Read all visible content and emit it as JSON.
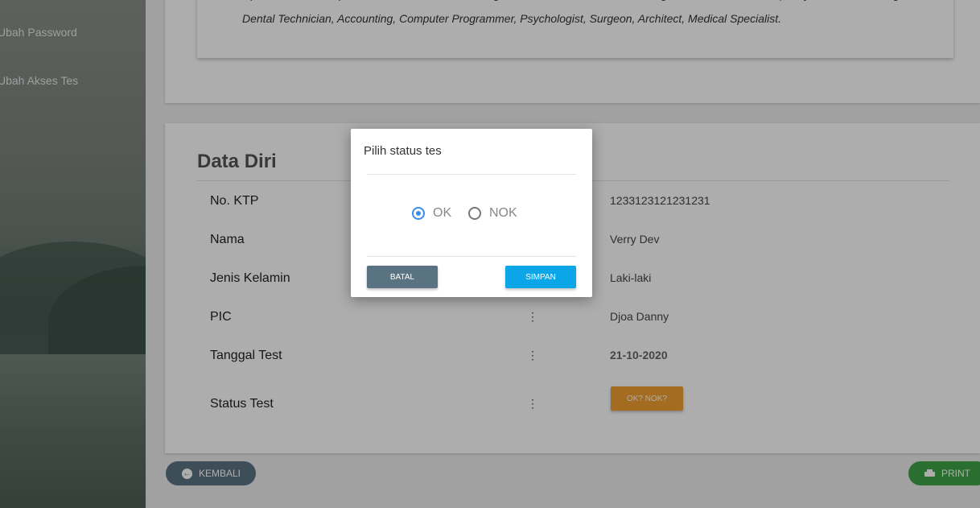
{
  "sidebar": {
    "items": [
      {
        "label": "Ubah Password"
      },
      {
        "label": "Ubah Akses Tes"
      }
    ]
  },
  "top_card": {
    "line1": "Optician, Medical Specialist, Health Care, IT Management, Planner, Technical Writing, Production, Dentist, Quality Control, Planning,",
    "line2": "Dental Technician, Accounting, Computer Programmer, Psychologist, Surgeon, Architect, Medical Specialist."
  },
  "data_diri": {
    "title": "Data Diri",
    "separator": "⋮",
    "rows": [
      {
        "label": "No. KTP",
        "value": "1233123121231231"
      },
      {
        "label": "Nama",
        "value": "Verry Dev"
      },
      {
        "label": "Jenis Kelamin",
        "value": "Laki-laki"
      },
      {
        "label": "PIC",
        "value": "Djoa Danny"
      },
      {
        "label": "Tanggal Test",
        "value": "21-10-2020"
      },
      {
        "label": "Status Test",
        "button_label": "OK? NOK?"
      }
    ]
  },
  "footer": {
    "back_label": "KEMBALI",
    "print_label": "PRINT"
  },
  "modal": {
    "title": "Pilih status tes",
    "options": [
      {
        "label": "OK",
        "checked": true
      },
      {
        "label": "NOK",
        "checked": false
      }
    ],
    "cancel_label": "BATAL",
    "save_label": "SIMPAN"
  },
  "colors": {
    "status_button": "#f0a030",
    "save_button": "#0aa6e8",
    "cancel_button": "#5a7383",
    "print_button": "#3fa447",
    "radio_checked": "#3b8ee8"
  }
}
